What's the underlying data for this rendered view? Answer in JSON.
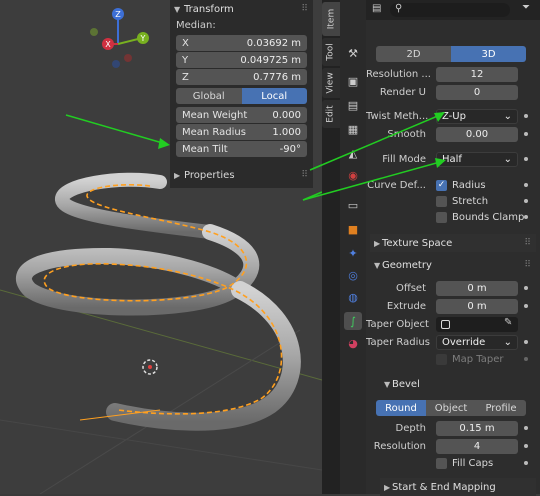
{
  "npanel": {
    "transform_title": "Transform",
    "median_label": "Median:",
    "fields": [
      {
        "k": "X",
        "v": "0.03692 m"
      },
      {
        "k": "Y",
        "v": "0.049725 m"
      },
      {
        "k": "Z",
        "v": "0.7776 m"
      }
    ],
    "space": [
      "Global",
      "Local"
    ],
    "extra": [
      {
        "k": "Mean Weight",
        "v": "0.000"
      },
      {
        "k": "Mean Radius",
        "v": "1.000"
      },
      {
        "k": "Mean Tilt",
        "v": "-90°"
      }
    ],
    "properties_label": "Properties"
  },
  "gizmo": {
    "z": "Z",
    "y": "Y",
    "x": "X"
  },
  "tabs": [
    "Item",
    "Tool",
    "View",
    "Edit"
  ],
  "shape": {
    "dim_tabs": [
      "2D",
      "3D"
    ],
    "resolution_label": "Resolution ...",
    "resolution_value": "12",
    "render_u_label": "Render U",
    "render_u_value": "0",
    "twist_label": "Twist Meth...",
    "twist_value": "Z-Up",
    "smooth_label": "Smooth",
    "smooth_value": "0.00",
    "fill_label": "Fill Mode",
    "fill_value": "Half",
    "curve_def_label": "Curve Def...",
    "radius_label": "Radius",
    "stretch_label": "Stretch",
    "bounds_label": "Bounds Clamp"
  },
  "texture_space": "Texture Space",
  "geometry": {
    "title": "Geometry",
    "offset_label": "Offset",
    "offset_value": "0 m",
    "extrude_label": "Extrude",
    "extrude_value": "0 m",
    "taper_obj_label": "Taper Object",
    "taper_radius_label": "Taper Radius",
    "taper_radius_value": "Override",
    "map_taper_label": "Map Taper"
  },
  "bevel": {
    "title": "Bevel",
    "modes": [
      "Round",
      "Object",
      "Profile"
    ],
    "depth_label": "Depth",
    "depth_value": "0.15 m",
    "resolution_label": "Resolution",
    "resolution_value": "4",
    "fill_caps_label": "Fill Caps"
  },
  "start_end": "Start & End Mapping",
  "colors": {
    "accent": "#4772b3",
    "arrow": "#22cc22",
    "curve": "#ffa020"
  }
}
